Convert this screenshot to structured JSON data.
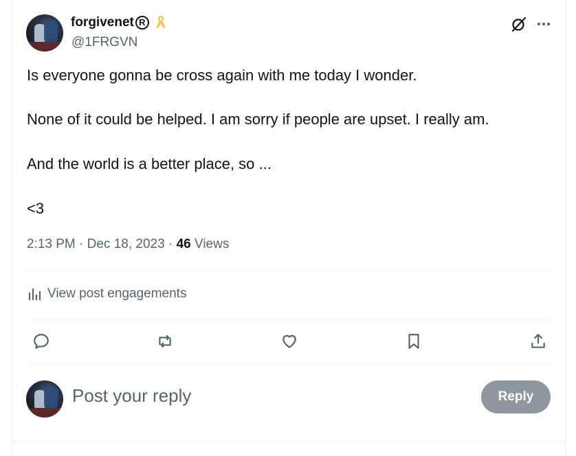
{
  "author": {
    "display_name": "forgivenet",
    "handle": "@1FRGVN"
  },
  "post": {
    "paragraphs": [
      "Is everyone gonna be cross again with me today I wonder.",
      "None of it could be helped. I am sorry if people are upset. I really am.",
      "And the world is a better place, so ...",
      "<3"
    ],
    "time": "2:13 PM",
    "separator": "·",
    "date": "Dec 18, 2023",
    "views_count": "46",
    "views_label": "Views"
  },
  "engagements": {
    "label": "View post engagements"
  },
  "reply_box": {
    "placeholder": "Post your reply",
    "button_label": "Reply"
  },
  "icons": {
    "registered": "registered-icon",
    "ribbon": "awareness-ribbon-icon",
    "grok": "grok-icon",
    "more": "more-icon",
    "engagements": "bar-chart-icon",
    "reply": "reply-icon",
    "repost": "repost-icon",
    "like": "heart-icon",
    "bookmark": "bookmark-icon",
    "share": "share-icon"
  },
  "colors": {
    "text_primary": "#0f1419",
    "text_secondary": "#536471",
    "ribbon": "#f5c24a",
    "reply_button_bg": "#8e979e",
    "divider": "#eff3f4"
  }
}
